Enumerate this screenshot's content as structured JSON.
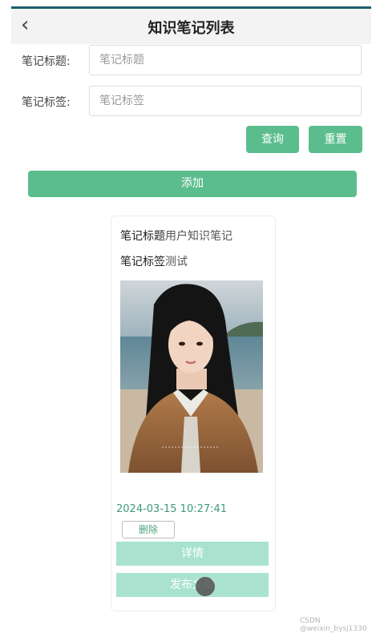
{
  "header": {
    "back_icon": "chevron-left-icon",
    "title": "知识笔记列表"
  },
  "search": {
    "title_label": "笔记标题:",
    "title_placeholder": "笔记标题",
    "tag_label": "笔记标签:",
    "tag_placeholder": "笔记标签",
    "query_label": "查询",
    "reset_label": "重置"
  },
  "add_label": "添加",
  "card": {
    "title_key": "笔记标题",
    "title_value": "用户知识笔记",
    "tag_key": "笔记标签",
    "tag_value": "测试",
    "image": "portrait-photo",
    "date": "2024-03-15 10:27:41",
    "delete_label": "删除",
    "detail_label": "详情",
    "publish_label": "发布",
    "publish_label_tail": "文章"
  },
  "watermark": "CSDN @weixin_bysj1330",
  "colors": {
    "accent": "#5bbd8d",
    "accent_light": "#a9e3cf",
    "date": "#3c9a78",
    "topline": "#1f5f6e"
  }
}
